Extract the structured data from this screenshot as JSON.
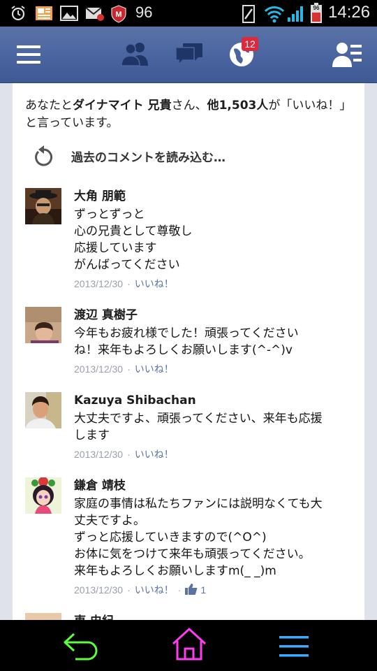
{
  "status_bar": {
    "notification_count": "96",
    "battery_level": "96",
    "time": "14:26",
    "icons": [
      "alarm-icon",
      "news-icon",
      "gallery-icon",
      "mail-icon",
      "mcafee-icon",
      "nfc-icon",
      "wifi-icon",
      "signal-icon",
      "battery-icon"
    ]
  },
  "header": {
    "icons": [
      "menu-icon",
      "friends-icon",
      "messages-icon",
      "notifications-globe-icon",
      "friend-list-icon"
    ],
    "notification_badge": "12",
    "colors": {
      "bar": "#4a64a0",
      "badge": "#e0283d"
    }
  },
  "likes_summary": {
    "prefix": "あなたと",
    "name": "ダイナマイト 兄貴",
    "middle": "さん、",
    "count_text": "他1,503人",
    "suffix": "が「いいね！」と言っています。"
  },
  "load_previous": {
    "label": "過去のコメントを読み込む…"
  },
  "comments": [
    {
      "name": "大角 朋範",
      "text": "ずっとずっと\n心の兄貴として尊敬し\n応援しています\nがんばってください",
      "date": "2013/12/30",
      "like_label": "いいね！"
    },
    {
      "name": "渡辺 真樹子",
      "text": "今年もお疲れ様でした！頑張ってください\nね！来年もよろしくお願いします(^-^)v",
      "date": "2013/12/30",
      "like_label": "いいね！"
    },
    {
      "name": "Kazuya Shibachan",
      "text": "大丈夫ですよ、頑張ってください、来年も応援\nします",
      "date": "2013/12/30",
      "like_label": "いいね！"
    },
    {
      "name": "鎌倉 靖枝",
      "text": "家庭の事情は私たちファンには説明なくても大\n丈夫ですよ。\nずっと応援していきますので(^O^)\nお体に気をつけて来年も頑張ってください。\n来年もよろしくお願いしますm(_ _)m",
      "date": "2013/12/30",
      "like_label": "いいね！",
      "like_count": "1"
    },
    {
      "name": "東 史紀"
    }
  ],
  "nav_bar": {
    "icons": [
      "back-icon",
      "home-icon",
      "menu-icon"
    ],
    "colors": {
      "back": "#5cff3c",
      "home": "#ff3cf0",
      "menu": "#3fa9ff"
    }
  }
}
